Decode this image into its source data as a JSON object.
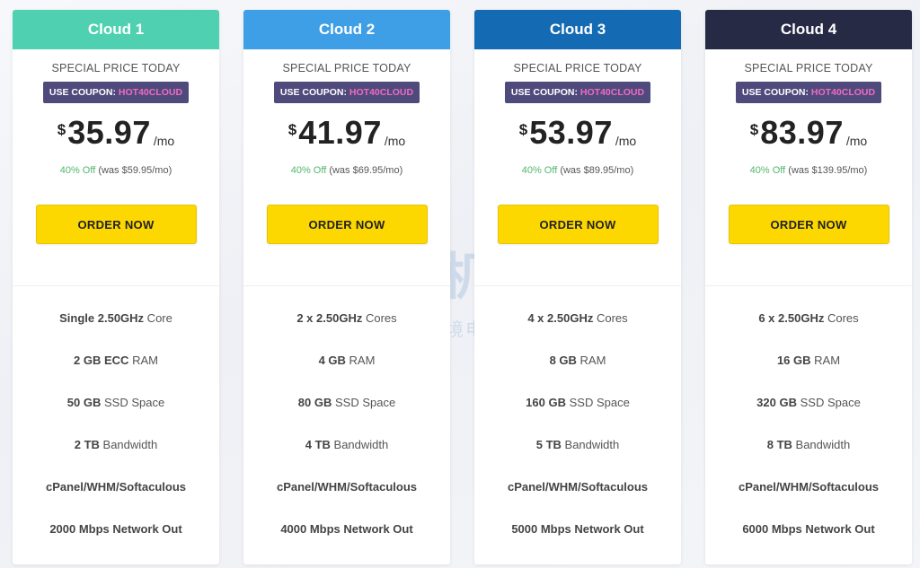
{
  "watermark": {
    "main": "主机侦探",
    "sub": "服务跨境电商·助力中企出海"
  },
  "plans": [
    {
      "name": "Cloud 1",
      "header_color": "#4fd1b1",
      "special": "SPECIAL PRICE TODAY",
      "coupon_label": "USE COUPON:",
      "coupon_code": "HOT40CLOUD",
      "currency": "$",
      "price": "35.97",
      "period": "/mo",
      "discount": "40% Off",
      "was": "(was $59.95/mo)",
      "order_label": "ORDER NOW",
      "features": [
        {
          "bold": "Single 2.50GHz",
          "rest": " Core"
        },
        {
          "bold": "2 GB ECC",
          "rest": " RAM"
        },
        {
          "bold": "50 GB",
          "rest": " SSD Space"
        },
        {
          "bold": "2 TB",
          "rest": " Bandwidth"
        },
        {
          "bold": "cPanel/WHM/Softaculous",
          "rest": ""
        },
        {
          "bold": "2000 Mbps Network Out",
          "rest": ""
        }
      ]
    },
    {
      "name": "Cloud 2",
      "header_color": "#3e9fe6",
      "special": "SPECIAL PRICE TODAY",
      "coupon_label": "USE COUPON:",
      "coupon_code": "HOT40CLOUD",
      "currency": "$",
      "price": "41.97",
      "period": "/mo",
      "discount": "40% Off",
      "was": "(was $69.95/mo)",
      "order_label": "ORDER NOW",
      "features": [
        {
          "bold": "2 x 2.50GHz",
          "rest": " Cores"
        },
        {
          "bold": "4 GB",
          "rest": " RAM"
        },
        {
          "bold": "80 GB",
          "rest": " SSD Space"
        },
        {
          "bold": "4 TB",
          "rest": " Bandwidth"
        },
        {
          "bold": "cPanel/WHM/Softaculous",
          "rest": ""
        },
        {
          "bold": "4000 Mbps Network Out",
          "rest": ""
        }
      ]
    },
    {
      "name": "Cloud 3",
      "header_color": "#156bb3",
      "special": "SPECIAL PRICE TODAY",
      "coupon_label": "USE COUPON:",
      "coupon_code": "HOT40CLOUD",
      "currency": "$",
      "price": "53.97",
      "period": "/mo",
      "discount": "40% Off",
      "was": "(was $89.95/mo)",
      "order_label": "ORDER NOW",
      "features": [
        {
          "bold": "4 x 2.50GHz",
          "rest": " Cores"
        },
        {
          "bold": "8 GB",
          "rest": " RAM"
        },
        {
          "bold": "160 GB",
          "rest": " SSD Space"
        },
        {
          "bold": "5 TB",
          "rest": " Bandwidth"
        },
        {
          "bold": "cPanel/WHM/Softaculous",
          "rest": ""
        },
        {
          "bold": "5000 Mbps Network Out",
          "rest": ""
        }
      ]
    },
    {
      "name": "Cloud 4",
      "header_color": "#272a45",
      "special": "SPECIAL PRICE TODAY",
      "coupon_label": "USE COUPON:",
      "coupon_code": "HOT40CLOUD",
      "currency": "$",
      "price": "83.97",
      "period": "/mo",
      "discount": "40% Off",
      "was": "(was $139.95/mo)",
      "order_label": "ORDER NOW",
      "features": [
        {
          "bold": "6 x 2.50GHz",
          "rest": " Cores"
        },
        {
          "bold": "16 GB",
          "rest": " RAM"
        },
        {
          "bold": "320 GB",
          "rest": " SSD Space"
        },
        {
          "bold": "8 TB",
          "rest": " Bandwidth"
        },
        {
          "bold": "cPanel/WHM/Softaculous",
          "rest": ""
        },
        {
          "bold": "6000 Mbps Network Out",
          "rest": ""
        }
      ]
    }
  ]
}
